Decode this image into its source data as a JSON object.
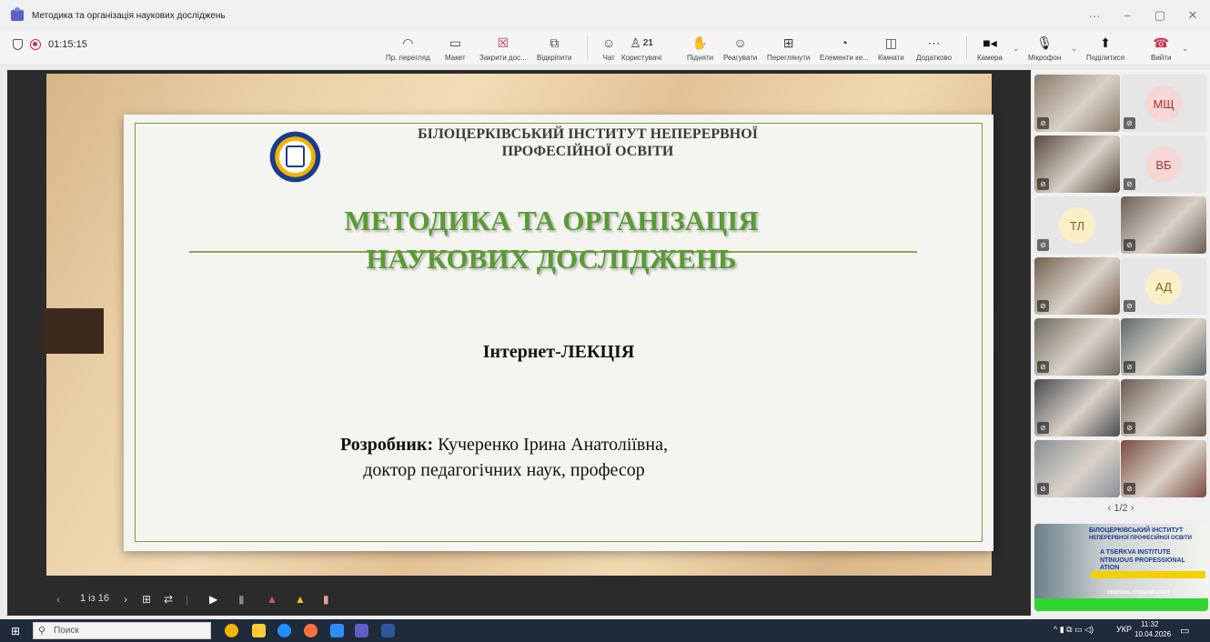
{
  "window": {
    "title": "Методика та організація наукових досліджень",
    "controls": [
      "···",
      "−",
      "▢",
      "✕"
    ]
  },
  "meeting": {
    "timer": "01:15:15"
  },
  "toolbar": {
    "items": [
      {
        "label": "Пр. перегляд",
        "icon": "eye-icon"
      },
      {
        "label": "Макет",
        "icon": "layout-icon"
      },
      {
        "label": "Закрити дос...",
        "icon": "close-share-icon"
      },
      {
        "label": "Відкріпити",
        "icon": "unpin-icon"
      },
      {
        "label": "Чат",
        "icon": "chat-icon"
      },
      {
        "label": "Користувачі",
        "icon": "people-icon",
        "badge": "21"
      },
      {
        "label": "Підняти",
        "icon": "raise-hand-icon"
      },
      {
        "label": "Реагувати",
        "icon": "smiley-icon"
      },
      {
        "label": "Переглянути",
        "icon": "view-grid-icon"
      },
      {
        "label": "Елементи ке...",
        "icon": "apps-icon"
      },
      {
        "label": "Кімнати",
        "icon": "rooms-icon"
      },
      {
        "label": "Додатково",
        "icon": "more-icon"
      },
      {
        "label": "Камера",
        "icon": "camera-icon"
      },
      {
        "label": "Мікрофон",
        "icon": "microphone-icon"
      },
      {
        "label": "Поділитися",
        "icon": "share-icon"
      },
      {
        "label": "Вийти",
        "icon": "hang-up-icon"
      }
    ]
  },
  "slide": {
    "institute_line1": "БІЛОЦЕРКІВСЬКИЙ ІНСТИТУТ НЕПЕРЕРВНОЇ",
    "institute_line2": "ПРОФЕСІЙНОЇ ОСВІТИ",
    "title_line1": "МЕТОДИКА ТА ОРГАНІЗАЦІЯ",
    "title_line2": "НАУКОВИХ ДОСЛІДЖЕНЬ",
    "lecture_type": "Інтернет-ЛЕКЦІЯ",
    "author_label": "Розробник:",
    "author_name": " Кучеренко Ірина Анатоліївна,",
    "author_degree": "доктор педагогічних наук, професор",
    "page_indicator": "1 із 16"
  },
  "participants": [
    {
      "kind": "video",
      "color": "#8a7a6a"
    },
    {
      "kind": "avatar",
      "initials": "МЩ",
      "bg": "#f6d6d6",
      "fg": "#a33"
    },
    {
      "kind": "video",
      "color": "#5a4a40"
    },
    {
      "kind": "avatar",
      "initials": "ВБ",
      "bg": "#f6d6d6",
      "fg": "#a33"
    },
    {
      "kind": "avatar",
      "initials": "ТЛ",
      "bg": "#fbefc7",
      "fg": "#7a6520"
    },
    {
      "kind": "video",
      "color": "#6b5e55"
    },
    {
      "kind": "video",
      "color": "#746050"
    },
    {
      "kind": "avatar",
      "initials": "АД",
      "bg": "#fbefc7",
      "fg": "#7a6520"
    },
    {
      "kind": "video",
      "color": "#6e6a5e"
    },
    {
      "kind": "video",
      "color": "#5e6a6a"
    },
    {
      "kind": "video",
      "color": "#4a4a52"
    },
    {
      "kind": "video",
      "color": "#6a5a50"
    },
    {
      "kind": "video",
      "color": "#8a8f96"
    },
    {
      "kind": "video",
      "color": "#7a4a40"
    }
  ],
  "pager": {
    "text": "1/2"
  },
  "preview": {
    "line1": "БІЛОЦЕРКІВСЬКИЙ ІНСТИТУТ",
    "line2": "НЕПЕРЕРВНОЇ ПРОФЕСІЙНОЇ ОСВІТИ",
    "line3": "A TSERKVA INSTITUTE",
    "line4": "NTINUOUS PROFESSIONAL",
    "line5": "ATION",
    "line6": "ОБОЛОНЬ СПІЛЬНІЙ СТАРТ"
  },
  "taskbar": {
    "search_placeholder": "Поиск",
    "language": "УКР",
    "time": "11:32",
    "date": "10.04.2026"
  }
}
